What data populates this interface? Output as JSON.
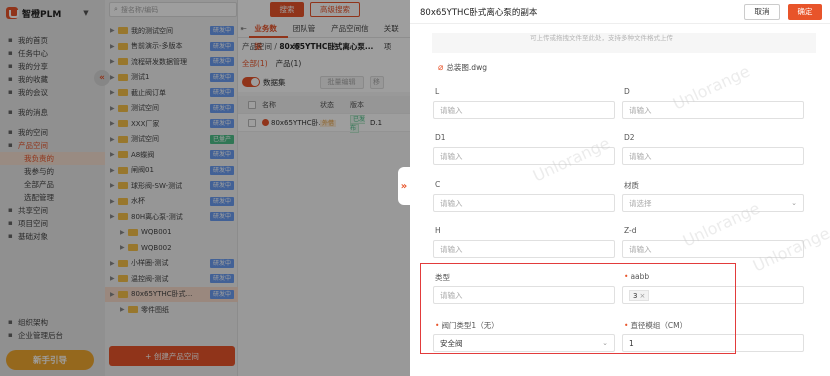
{
  "app": {
    "name": "智橙PLM"
  },
  "nav": {
    "items": [
      {
        "label": "我的首页",
        "icon": "home-icon",
        "sub": false,
        "active": false,
        "parent_active": false,
        "gap_after": false
      },
      {
        "label": "任务中心",
        "icon": "task-icon",
        "sub": false,
        "active": false,
        "parent_active": false,
        "gap_after": false
      },
      {
        "label": "我的分享",
        "icon": "share-icon",
        "sub": false,
        "active": false,
        "parent_active": false,
        "gap_after": false
      },
      {
        "label": "我的收藏",
        "icon": "star-icon",
        "sub": false,
        "active": false,
        "parent_active": false,
        "gap_after": false
      },
      {
        "label": "我的会议",
        "icon": "meeting-icon",
        "sub": false,
        "active": false,
        "parent_active": false,
        "gap_after": true
      },
      {
        "label": "我的消息",
        "icon": "message-icon",
        "sub": false,
        "active": false,
        "parent_active": false,
        "gap_after": true
      },
      {
        "label": "我的空间",
        "icon": "space-icon",
        "sub": false,
        "active": false,
        "parent_active": false,
        "gap_after": false
      },
      {
        "label": "产品空间",
        "icon": "product-icon",
        "sub": false,
        "active": false,
        "parent_active": true,
        "gap_after": false
      },
      {
        "label": "我负责的",
        "icon": "",
        "sub": true,
        "active": true,
        "parent_active": false,
        "gap_after": false
      },
      {
        "label": "我参与的",
        "icon": "",
        "sub": true,
        "active": false,
        "parent_active": false,
        "gap_after": false
      },
      {
        "label": "全部产品",
        "icon": "",
        "sub": true,
        "active": false,
        "parent_active": false,
        "gap_after": false
      },
      {
        "label": "选配管理",
        "icon": "",
        "sub": true,
        "active": false,
        "parent_active": false,
        "gap_after": false
      },
      {
        "label": "共享空间",
        "icon": "shared-icon",
        "sub": false,
        "active": false,
        "parent_active": false,
        "gap_after": false
      },
      {
        "label": "项目空间",
        "icon": "project-icon",
        "sub": false,
        "active": false,
        "parent_active": false,
        "gap_after": false
      },
      {
        "label": "基础对象",
        "icon": "object-icon",
        "sub": false,
        "active": false,
        "parent_active": false,
        "gap_after": false
      }
    ],
    "bottom": [
      {
        "label": "组织架构",
        "icon": "org-icon"
      },
      {
        "label": "企业管理后台",
        "icon": "admin-icon"
      }
    ],
    "guide_label": "新手引导"
  },
  "tree": {
    "search_placeholder": "搜名称/编码",
    "rows": [
      {
        "label": "我的测试空间",
        "badge": "研发中",
        "badge_color": "blue",
        "indent": false,
        "folder": false,
        "selected": false
      },
      {
        "label": "售前演示-多版本",
        "badge": "研发中",
        "badge_color": "blue",
        "indent": false,
        "folder": false,
        "selected": false
      },
      {
        "label": "流程研发数据管理",
        "badge": "研发中",
        "badge_color": "blue",
        "indent": false,
        "folder": false,
        "selected": false
      },
      {
        "label": "测试1",
        "badge": "研发中",
        "badge_color": "blue",
        "indent": false,
        "folder": false,
        "selected": false
      },
      {
        "label": "截止阀订单",
        "badge": "研发中",
        "badge_color": "blue",
        "indent": false,
        "folder": false,
        "selected": false
      },
      {
        "label": "测试空间",
        "badge": "研发中",
        "badge_color": "blue",
        "indent": false,
        "folder": false,
        "selected": false
      },
      {
        "label": "XXX厂家",
        "badge": "研发中",
        "badge_color": "blue",
        "indent": false,
        "folder": false,
        "selected": false
      },
      {
        "label": "测试空间",
        "badge": "已量产",
        "badge_color": "blue",
        "indent": false,
        "folder": false,
        "selected": false
      },
      {
        "label": "A8蝶阀",
        "badge": "研发中",
        "badge_color": "blue",
        "indent": false,
        "folder": false,
        "selected": false
      },
      {
        "label": "闸阀01",
        "badge": "研发中",
        "badge_color": "blue",
        "indent": false,
        "folder": false,
        "selected": false
      },
      {
        "label": "球形阀-SW-测试",
        "badge": "研发中",
        "badge_color": "blue",
        "indent": false,
        "folder": false,
        "selected": false
      },
      {
        "label": "水杯",
        "badge": "研发中",
        "badge_color": "blue",
        "indent": false,
        "folder": false,
        "selected": false
      },
      {
        "label": "80H离心泵-测试",
        "badge": "研发中",
        "badge_color": "blue",
        "indent": false,
        "folder": false,
        "selected": false
      },
      {
        "label": "WQB001",
        "badge": "",
        "badge_color": "",
        "indent": true,
        "folder": true,
        "selected": false
      },
      {
        "label": "WQB002",
        "badge": "",
        "badge_color": "",
        "indent": true,
        "folder": true,
        "selected": false
      },
      {
        "label": "小样圈-测试",
        "badge": "研发中",
        "badge_color": "blue",
        "indent": false,
        "folder": false,
        "selected": false
      },
      {
        "label": "温控阀-测试",
        "badge": "研发中",
        "badge_color": "blue",
        "indent": false,
        "folder": false,
        "selected": false
      },
      {
        "label": "80x65YTHC卧式...",
        "badge": "研发中",
        "badge_color": "blue",
        "indent": false,
        "folder": false,
        "selected": true
      },
      {
        "label": "零件图纸",
        "badge": "",
        "badge_color": "",
        "indent": true,
        "folder": true,
        "selected": false
      }
    ],
    "create_label": "+ 创建产品空间"
  },
  "search": {
    "search_label": "搜索",
    "advanced_label": "高级搜索"
  },
  "main": {
    "tabs": [
      "业务数据",
      "团队管理",
      "产品空间信息",
      "关联项"
    ],
    "crumb_root": "产品空间",
    "crumb_current": "80x65YTHC卧式离心泵...",
    "subtabs": [
      "全部(1)",
      "产品(1)"
    ],
    "toggle_label": "数据集",
    "batch_label": "批量编辑",
    "batch_label2": "移",
    "columns": [
      "名称",
      "状态",
      "版本"
    ],
    "row": {
      "name": "80x65YTHC卧...",
      "owner_badge": "外借",
      "status": "已发布",
      "version": "D.1"
    }
  },
  "drawer": {
    "title": "80x65YTHC卧式离心泵的副本",
    "cancel_label": "取消",
    "ok_label": "确定",
    "notice": "可上传或拖拽文件至此处，支持多种文件格式上传",
    "attachment": "总装图.dwg",
    "fields": [
      {
        "label": "L",
        "value": "",
        "placeholder": "请输入",
        "required": false,
        "type": "input"
      },
      {
        "label": "D",
        "value": "",
        "placeholder": "请输入",
        "required": false,
        "type": "input"
      },
      {
        "label": "D1",
        "value": "",
        "placeholder": "请输入",
        "required": false,
        "type": "input"
      },
      {
        "label": "D2",
        "value": "",
        "placeholder": "请输入",
        "required": false,
        "type": "input"
      },
      {
        "label": "C",
        "value": "",
        "placeholder": "请输入",
        "required": false,
        "type": "input"
      },
      {
        "label": "材质",
        "value": "",
        "placeholder": "请选择",
        "required": false,
        "type": "select"
      },
      {
        "label": "H",
        "value": "",
        "placeholder": "请输入",
        "required": false,
        "type": "input"
      },
      {
        "label": "Z-d",
        "value": "",
        "placeholder": "请输入",
        "required": false,
        "type": "input"
      },
      {
        "label": "类型",
        "value": "",
        "placeholder": "请输入",
        "required": false,
        "type": "input"
      },
      {
        "label": "aabb",
        "value": "3",
        "placeholder": "",
        "required": true,
        "type": "tag"
      },
      {
        "label": "阀门类型1（无）",
        "value": "安全阀",
        "placeholder": "",
        "required": true,
        "type": "select"
      },
      {
        "label": "直径模组（CM）",
        "value": "1",
        "placeholder": "",
        "required": true,
        "type": "input"
      }
    ],
    "watermark": "Unlorange"
  },
  "colors": {
    "accent": "#e8542a",
    "highlight_box": "#e23b3b",
    "badge_blue": "#6b9df2",
    "badge_green": "#4ec18a"
  }
}
